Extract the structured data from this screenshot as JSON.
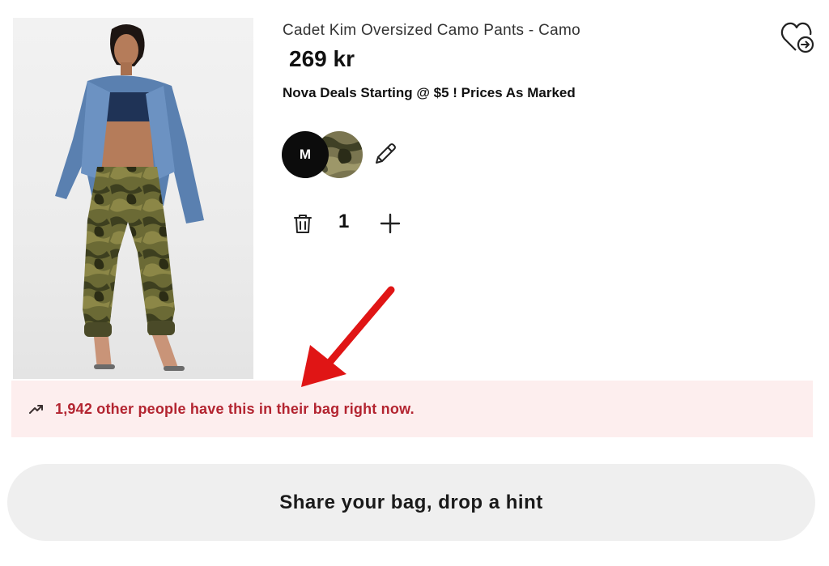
{
  "product": {
    "title": "Cadet Kim Oversized Camo Pants - Camo",
    "price": "269 kr",
    "promo": "Nova Deals Starting @ $5 ! Prices As Marked",
    "size": "M",
    "quantity": "1",
    "image_icon": "product-photo"
  },
  "icons": {
    "wishlist": "heart-arrow-icon",
    "edit": "pencil-icon",
    "remove": "trash-icon",
    "increase": "plus-icon",
    "trend": "trending-up-icon"
  },
  "social_proof": {
    "text": "1,942 other people have this in their bag right now."
  },
  "share": {
    "label": "Share your bag, drop a hint"
  },
  "colors": {
    "social_bg": "#fdeeee",
    "social_text": "#b32430",
    "annotation": "#e01515",
    "share_bg": "#efefef"
  }
}
